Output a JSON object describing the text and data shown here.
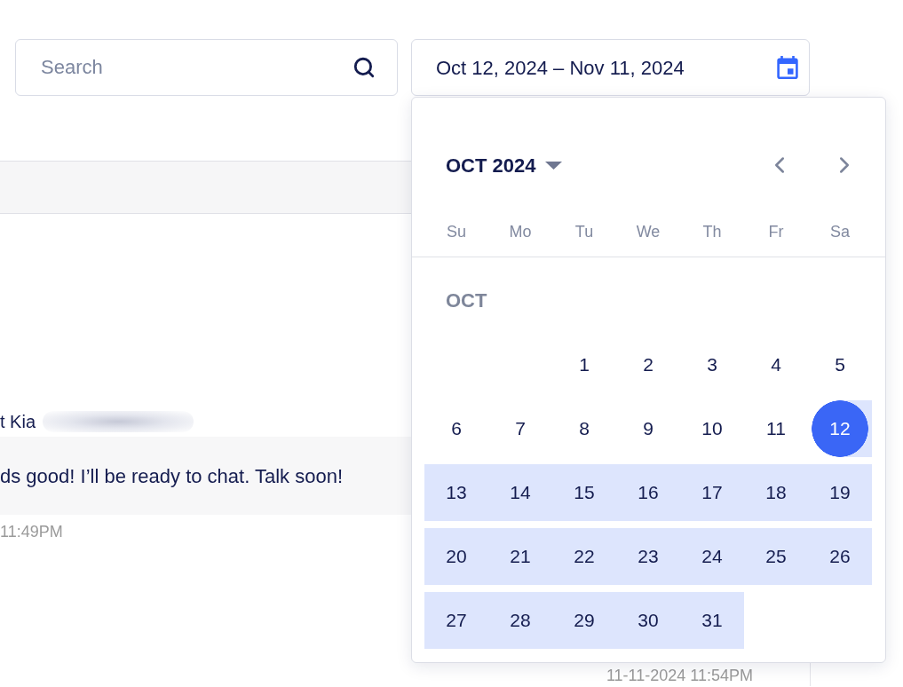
{
  "search_field": {
    "placeholder": "Search"
  },
  "date_range_field": {
    "value": "Oct 12, 2024 – Nov 11, 2024"
  },
  "conversation": {
    "messages": [
      {
        "sender": "t Kia",
        "text": "ds good! I’ll be ready to chat. Talk soon!",
        "time": "11:49PM"
      }
    ],
    "next_time": "11-11-2024 11:54PM"
  },
  "calendar": {
    "month_label": "OCT 2024",
    "weekdays": [
      "Su",
      "Mo",
      "Tu",
      "We",
      "Th",
      "Fr",
      "Sa"
    ],
    "months": [
      {
        "label": "OCT",
        "weeks": [
          {
            "days": [
              {
                "kind": "blank"
              },
              {
                "kind": "blank"
              },
              {
                "kind": "day",
                "label": "1",
                "selected": false,
                "in_range": false
              },
              {
                "kind": "day",
                "label": "2",
                "selected": false,
                "in_range": false
              },
              {
                "kind": "day",
                "label": "3",
                "selected": false,
                "in_range": false
              },
              {
                "kind": "day",
                "label": "4",
                "selected": false,
                "in_range": false
              },
              {
                "kind": "day",
                "label": "5",
                "selected": false,
                "in_range": false
              }
            ]
          },
          {
            "days": [
              {
                "kind": "day",
                "label": "6",
                "selected": false,
                "in_range": false
              },
              {
                "kind": "day",
                "label": "7",
                "selected": false,
                "in_range": false
              },
              {
                "kind": "day",
                "label": "8",
                "selected": false,
                "in_range": false
              },
              {
                "kind": "day",
                "label": "9",
                "selected": false,
                "in_range": false
              },
              {
                "kind": "day",
                "label": "10",
                "selected": false,
                "in_range": false
              },
              {
                "kind": "day",
                "label": "11",
                "selected": false,
                "in_range": false
              },
              {
                "kind": "day",
                "label": "12",
                "selected": true,
                "in_range": true
              }
            ]
          },
          {
            "days": [
              {
                "kind": "day",
                "label": "13",
                "selected": false,
                "in_range": true
              },
              {
                "kind": "day",
                "label": "14",
                "selected": false,
                "in_range": true
              },
              {
                "kind": "day",
                "label": "15",
                "selected": false,
                "in_range": true
              },
              {
                "kind": "day",
                "label": "16",
                "selected": false,
                "in_range": true
              },
              {
                "kind": "day",
                "label": "17",
                "selected": false,
                "in_range": true
              },
              {
                "kind": "day",
                "label": "18",
                "selected": false,
                "in_range": true
              },
              {
                "kind": "day",
                "label": "19",
                "selected": false,
                "in_range": true
              }
            ]
          },
          {
            "days": [
              {
                "kind": "day",
                "label": "20",
                "selected": false,
                "in_range": true
              },
              {
                "kind": "day",
                "label": "21",
                "selected": false,
                "in_range": true
              },
              {
                "kind": "day",
                "label": "22",
                "selected": false,
                "in_range": true
              },
              {
                "kind": "day",
                "label": "23",
                "selected": false,
                "in_range": true
              },
              {
                "kind": "day",
                "label": "24",
                "selected": false,
                "in_range": true
              },
              {
                "kind": "day",
                "label": "25",
                "selected": false,
                "in_range": true
              },
              {
                "kind": "day",
                "label": "26",
                "selected": false,
                "in_range": true
              }
            ]
          },
          {
            "days": [
              {
                "kind": "day",
                "label": "27",
                "selected": false,
                "in_range": true
              },
              {
                "kind": "day",
                "label": "28",
                "selected": false,
                "in_range": true
              },
              {
                "kind": "day",
                "label": "29",
                "selected": false,
                "in_range": true
              },
              {
                "kind": "day",
                "label": "30",
                "selected": false,
                "in_range": true
              },
              {
                "kind": "day",
                "label": "31",
                "selected": false,
                "in_range": true
              }
            ]
          }
        ]
      }
    ]
  }
}
